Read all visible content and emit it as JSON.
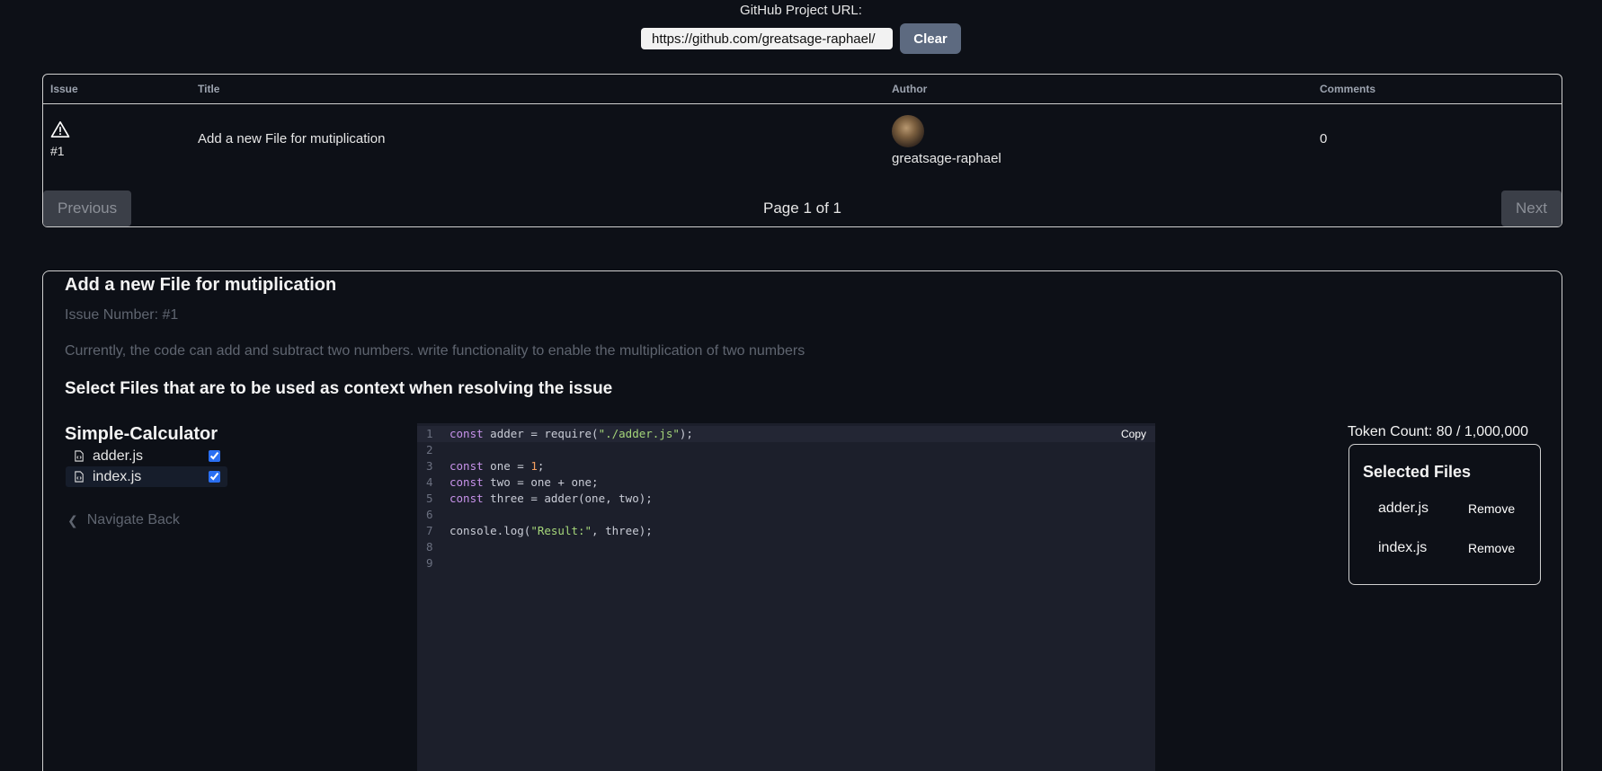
{
  "header": {
    "url_label": "GitHub Project URL:",
    "url_value": "https://github.com/greatsage-raphael/",
    "clear_label": "Clear"
  },
  "issues_table": {
    "columns": [
      "Issue",
      "Title",
      "Author",
      "Comments"
    ],
    "rows": [
      {
        "number": "#1",
        "title": "Add a new File for mutiplication",
        "author": "greatsage-raphael",
        "comments": "0"
      }
    ],
    "pagination": {
      "previous": "Previous",
      "page_indicator": "Page 1 of 1",
      "next": "Next"
    }
  },
  "issue_detail": {
    "title": "Add a new File for mutiplication",
    "number_text": "Issue Number: #1",
    "description": "Currently, the code can add and subtract two numbers. write functionality to enable the multiplication of two numbers",
    "select_heading": "Select Files that are to be used as context when resolving the issue"
  },
  "file_tree": {
    "root": "Simple-Calculator",
    "files": [
      {
        "name": "adder.js",
        "checked": true
      },
      {
        "name": "index.js",
        "checked": true
      }
    ],
    "navigate_back": "Navigate Back"
  },
  "code_viewer": {
    "copy_label": "Copy",
    "line_numbers": [
      "1",
      "2",
      "3",
      "4",
      "5",
      "6",
      "7",
      "8",
      "9"
    ],
    "lines": [
      "const adder = require(\"./adder.js\");",
      "",
      "const one = 1;",
      "const two = one + one;",
      "const three = adder(one, two);",
      "",
      "console.log(\"Result:\", three);",
      "",
      ""
    ]
  },
  "token_count": "Token Count: 80 / 1,000,000",
  "selected_files": {
    "title": "Selected Files",
    "items": [
      "adder.js",
      "index.js"
    ],
    "remove_label": "Remove"
  },
  "colors": {
    "background": "#0d1017",
    "clear_button": "#5d6a80",
    "code_background": "#1c1f2b",
    "checkbox_accent": "#2a6ff2"
  },
  "icons": [
    "warning-icon",
    "file-code-icon",
    "chevron-left-icon"
  ]
}
